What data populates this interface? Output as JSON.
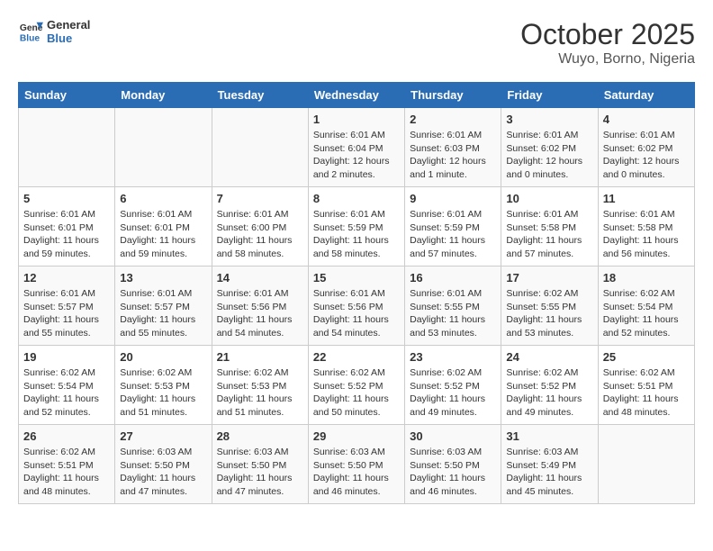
{
  "header": {
    "logo_general": "General",
    "logo_blue": "Blue",
    "title": "October 2025",
    "subtitle": "Wuyo, Borno, Nigeria"
  },
  "weekdays": [
    "Sunday",
    "Monday",
    "Tuesday",
    "Wednesday",
    "Thursday",
    "Friday",
    "Saturday"
  ],
  "weeks": [
    [
      null,
      null,
      null,
      {
        "day": "1",
        "sunrise": "6:01 AM",
        "sunset": "6:04 PM",
        "daylight": "12 hours and 2 minutes."
      },
      {
        "day": "2",
        "sunrise": "6:01 AM",
        "sunset": "6:03 PM",
        "daylight": "12 hours and 1 minute."
      },
      {
        "day": "3",
        "sunrise": "6:01 AM",
        "sunset": "6:02 PM",
        "daylight": "12 hours and 0 minutes."
      },
      {
        "day": "4",
        "sunrise": "6:01 AM",
        "sunset": "6:02 PM",
        "daylight": "12 hours and 0 minutes."
      }
    ],
    [
      {
        "day": "5",
        "sunrise": "6:01 AM",
        "sunset": "6:01 PM",
        "daylight": "11 hours and 59 minutes."
      },
      {
        "day": "6",
        "sunrise": "6:01 AM",
        "sunset": "6:01 PM",
        "daylight": "11 hours and 59 minutes."
      },
      {
        "day": "7",
        "sunrise": "6:01 AM",
        "sunset": "6:00 PM",
        "daylight": "11 hours and 58 minutes."
      },
      {
        "day": "8",
        "sunrise": "6:01 AM",
        "sunset": "5:59 PM",
        "daylight": "11 hours and 58 minutes."
      },
      {
        "day": "9",
        "sunrise": "6:01 AM",
        "sunset": "5:59 PM",
        "daylight": "11 hours and 57 minutes."
      },
      {
        "day": "10",
        "sunrise": "6:01 AM",
        "sunset": "5:58 PM",
        "daylight": "11 hours and 57 minutes."
      },
      {
        "day": "11",
        "sunrise": "6:01 AM",
        "sunset": "5:58 PM",
        "daylight": "11 hours and 56 minutes."
      }
    ],
    [
      {
        "day": "12",
        "sunrise": "6:01 AM",
        "sunset": "5:57 PM",
        "daylight": "11 hours and 55 minutes."
      },
      {
        "day": "13",
        "sunrise": "6:01 AM",
        "sunset": "5:57 PM",
        "daylight": "11 hours and 55 minutes."
      },
      {
        "day": "14",
        "sunrise": "6:01 AM",
        "sunset": "5:56 PM",
        "daylight": "11 hours and 54 minutes."
      },
      {
        "day": "15",
        "sunrise": "6:01 AM",
        "sunset": "5:56 PM",
        "daylight": "11 hours and 54 minutes."
      },
      {
        "day": "16",
        "sunrise": "6:01 AM",
        "sunset": "5:55 PM",
        "daylight": "11 hours and 53 minutes."
      },
      {
        "day": "17",
        "sunrise": "6:02 AM",
        "sunset": "5:55 PM",
        "daylight": "11 hours and 53 minutes."
      },
      {
        "day": "18",
        "sunrise": "6:02 AM",
        "sunset": "5:54 PM",
        "daylight": "11 hours and 52 minutes."
      }
    ],
    [
      {
        "day": "19",
        "sunrise": "6:02 AM",
        "sunset": "5:54 PM",
        "daylight": "11 hours and 52 minutes."
      },
      {
        "day": "20",
        "sunrise": "6:02 AM",
        "sunset": "5:53 PM",
        "daylight": "11 hours and 51 minutes."
      },
      {
        "day": "21",
        "sunrise": "6:02 AM",
        "sunset": "5:53 PM",
        "daylight": "11 hours and 51 minutes."
      },
      {
        "day": "22",
        "sunrise": "6:02 AM",
        "sunset": "5:52 PM",
        "daylight": "11 hours and 50 minutes."
      },
      {
        "day": "23",
        "sunrise": "6:02 AM",
        "sunset": "5:52 PM",
        "daylight": "11 hours and 49 minutes."
      },
      {
        "day": "24",
        "sunrise": "6:02 AM",
        "sunset": "5:52 PM",
        "daylight": "11 hours and 49 minutes."
      },
      {
        "day": "25",
        "sunrise": "6:02 AM",
        "sunset": "5:51 PM",
        "daylight": "11 hours and 48 minutes."
      }
    ],
    [
      {
        "day": "26",
        "sunrise": "6:02 AM",
        "sunset": "5:51 PM",
        "daylight": "11 hours and 48 minutes."
      },
      {
        "day": "27",
        "sunrise": "6:03 AM",
        "sunset": "5:50 PM",
        "daylight": "11 hours and 47 minutes."
      },
      {
        "day": "28",
        "sunrise": "6:03 AM",
        "sunset": "5:50 PM",
        "daylight": "11 hours and 47 minutes."
      },
      {
        "day": "29",
        "sunrise": "6:03 AM",
        "sunset": "5:50 PM",
        "daylight": "11 hours and 46 minutes."
      },
      {
        "day": "30",
        "sunrise": "6:03 AM",
        "sunset": "5:50 PM",
        "daylight": "11 hours and 46 minutes."
      },
      {
        "day": "31",
        "sunrise": "6:03 AM",
        "sunset": "5:49 PM",
        "daylight": "11 hours and 45 minutes."
      },
      null
    ]
  ]
}
